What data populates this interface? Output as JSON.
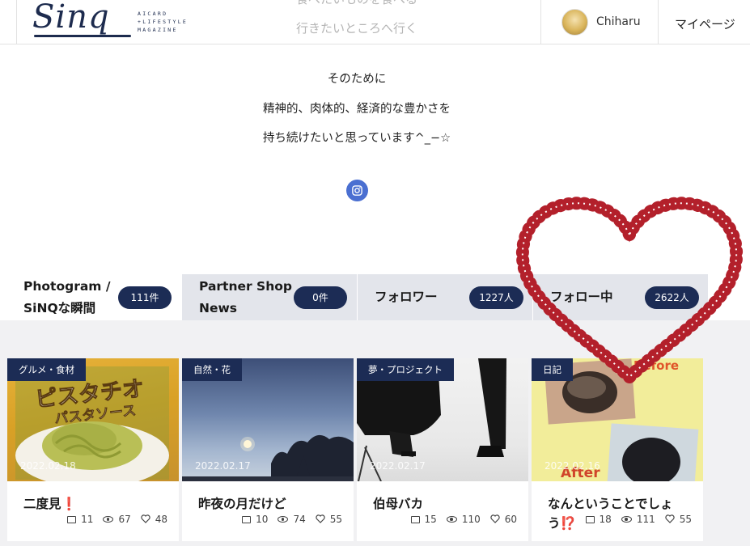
{
  "header": {
    "logo_text": "Sinq",
    "logo_tagline": "AICARD +LIFESTYLE MAGAZINE",
    "nav_line1": "食べたいものを食べる",
    "nav_line2": "行きたいところへ行く",
    "user_name": "Chiharu",
    "mypage_label": "マイページ"
  },
  "bio": {
    "line1": "そのために",
    "line2": "精神的、肉体的、経済的な豊かさを",
    "line3": "持ち続けたいと思っています^_−☆"
  },
  "social": {
    "icon": "instagram-icon",
    "color": "#4a6fd1"
  },
  "tabs": [
    {
      "label": "Photogram / SiNQな瞬間",
      "count": "111件",
      "active": true
    },
    {
      "label": "Partner Shop News",
      "count": "0件",
      "active": false
    },
    {
      "label": "フォロワー",
      "count": "1227人",
      "active": false
    },
    {
      "label": "フォロー中",
      "count": "2622人",
      "active": false
    }
  ],
  "cards": [
    {
      "category": "グルメ・食材",
      "date": "2022.02.18",
      "title": "二度見❗",
      "comments": "11",
      "views": "67",
      "likes": "48"
    },
    {
      "category": "自然・花",
      "date": "2022.02.17",
      "title": "昨夜の月だけど",
      "comments": "10",
      "views": "74",
      "likes": "55"
    },
    {
      "category": "夢・プロジェクト",
      "date": "2022.02.17",
      "title": "伯母バカ",
      "comments": "15",
      "views": "110",
      "likes": "60"
    },
    {
      "category": "日記",
      "date": "2022.02.16",
      "title": "なんということでしょう⁉️",
      "comments": "18",
      "views": "111",
      "likes": "55"
    }
  ],
  "thumb_text": {
    "card1_product": "ピスタチオ",
    "card1_sub": "パスタソース",
    "card4_before": "Before",
    "card4_after": "After"
  },
  "colors": {
    "navy": "#1c2c55",
    "tab_bg": "#e3e5eb",
    "heart_border": "#b3202b"
  }
}
